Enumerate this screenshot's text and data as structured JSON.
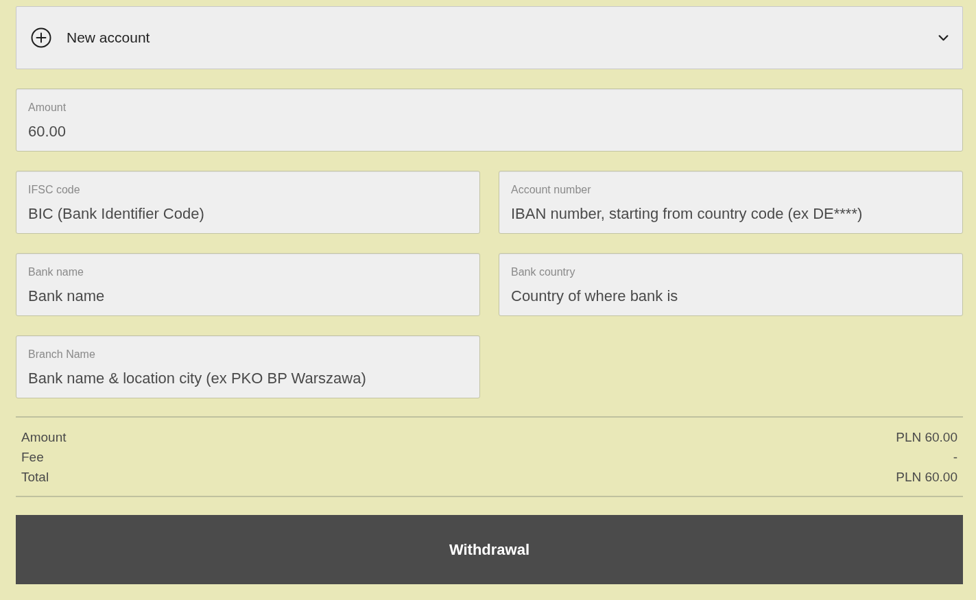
{
  "account_select": {
    "label": "New account"
  },
  "amount_field": {
    "label": "Amount",
    "value": "60.00"
  },
  "bank_fields": [
    {
      "label": "IFSC code",
      "placeholder": "BIC (Bank Identifier Code)"
    },
    {
      "label": "Account number",
      "placeholder": "IBAN number, starting from country code (ex DE****)"
    },
    {
      "label": "Bank name",
      "placeholder": "Bank name"
    },
    {
      "label": "Bank country",
      "placeholder": "Country of where bank is"
    },
    {
      "label": "Branch Name",
      "placeholder": "Bank name & location city (ex PKO BP Warszawa)"
    }
  ],
  "summary": [
    {
      "label": "Amount",
      "value": "PLN 60.00"
    },
    {
      "label": "Fee",
      "value": "-"
    },
    {
      "label": "Total",
      "value": "PLN 60.00"
    }
  ],
  "submit_button": "Withdrawal"
}
